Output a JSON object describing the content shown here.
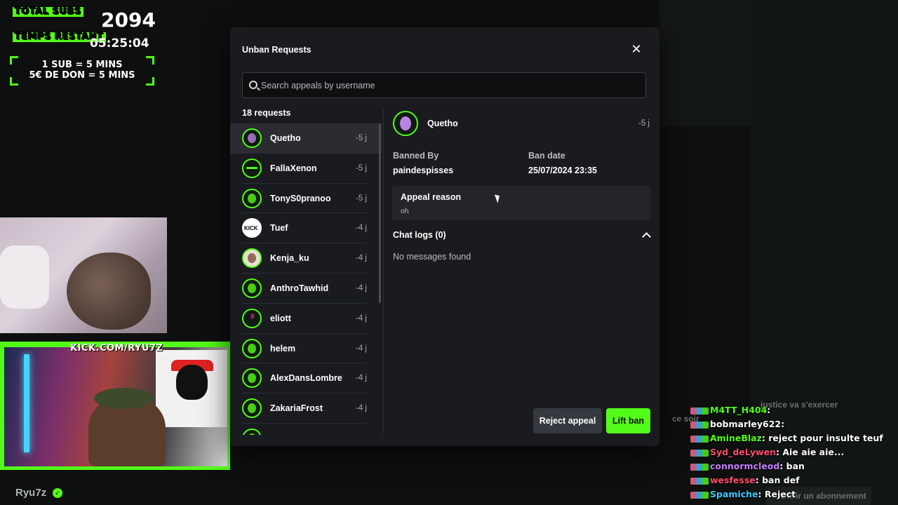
{
  "overlay": {
    "total_subs_label": "TOTAL SUBS",
    "total_subs_value": "2094",
    "time_left_label": "TEMPS RESTANT",
    "time_left_value": "05:25:04",
    "rule_1": "1 SUB = 5 MINS",
    "rule_2": "5€ DE DON = 5 MINS",
    "kick_url": "KICK.COM/RYU7Z",
    "streamer_name": "Ryu7z",
    "accent_color": "#53fc18"
  },
  "modal": {
    "title": "Unban Requests",
    "close_icon": "close-icon",
    "search_placeholder": "Search appeals by username",
    "request_count": "18 requests",
    "requests": [
      {
        "name": "Quetho",
        "time": "-5 j"
      },
      {
        "name": "FallaXenon",
        "time": "-5 j"
      },
      {
        "name": "TonyS0pranoo",
        "time": "-5 j"
      },
      {
        "name": "Tuef",
        "time": "-4 j"
      },
      {
        "name": "Kenja_ku",
        "time": "-4 j"
      },
      {
        "name": "AnthroTawhid",
        "time": "-4 j"
      },
      {
        "name": "eliott",
        "time": "-4 j"
      },
      {
        "name": "helem",
        "time": "-4 j"
      },
      {
        "name": "AlexDansLombre",
        "time": "-4 j"
      },
      {
        "name": "ZakariaFrost",
        "time": "-4 j"
      }
    ],
    "detail": {
      "name": "Quetho",
      "time": "-5 j",
      "banned_by_label": "Banned By",
      "banned_by": "paindespisses",
      "ban_date_label": "Ban date",
      "ban_date": "25/07/2024 23:35",
      "appeal_reason_label": "Appeal reason",
      "appeal_reason": "oh",
      "chat_logs_label": "Chat logs (0)",
      "no_messages": "No messages found"
    },
    "reject_label": "Reject appeal",
    "lift_label": "Lift ban"
  },
  "chat": [
    {
      "user": "M4TT_H404",
      "color": "#53fc18",
      "msg": ""
    },
    {
      "user": "bobmarley622",
      "color": "#ffffff",
      "msg": ""
    },
    {
      "user": "AmineBlaz",
      "color": "#53fc18",
      "msg": "reject pour insulte teuf"
    },
    {
      "user": "Syd_deLywen",
      "color": "#ff4d6d",
      "msg": "Aie aie aie..."
    },
    {
      "user": "connormcleod",
      "color": "#c77dff",
      "msg": "ban"
    },
    {
      "user": "wesfesse",
      "color": "#ff4d6d",
      "msg": "ban def"
    },
    {
      "user": "Spamiche",
      "color": "#3ec8ff",
      "msg": "Reject"
    }
  ],
  "background_chat": {
    "line_1": "justice va s'exercer",
    "line_2": "ce soir",
    "sub_button": "Offrir un abonnement"
  }
}
